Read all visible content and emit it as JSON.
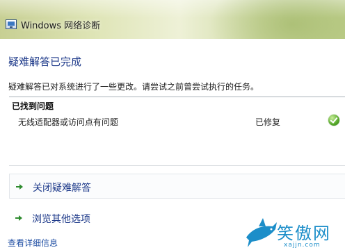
{
  "window": {
    "title": "Windows 网络诊断",
    "icon": "network-diagnostics-icon"
  },
  "main": {
    "heading": "疑难解答已完成",
    "description": "疑难解答已对系统进行了一些更改。请尝试之前曾尝试执行的任务。"
  },
  "problems": {
    "header": "已找到问题",
    "items": [
      {
        "name": "无线适配器或访问点有问题",
        "status": "已修复",
        "status_icon": "check-icon"
      }
    ]
  },
  "options": {
    "close_label": "关闭疑难解答",
    "browse_label": "浏览其他选项"
  },
  "footer": {
    "details_link": "查看详细信息"
  },
  "watermark": {
    "text": "笑傲网",
    "url": "xajjn.com"
  },
  "colors": {
    "heading": "#1e3a8a",
    "link": "#1f4ea3",
    "arrow": "#2e8b2e",
    "success": "#56a82a"
  }
}
